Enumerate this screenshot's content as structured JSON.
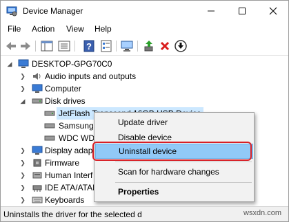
{
  "window": {
    "title": "Device Manager"
  },
  "menu": [
    "File",
    "Action",
    "View",
    "Help"
  ],
  "tree": {
    "root": "DESKTOP-GPG70C0",
    "items": [
      {
        "label": "Audio inputs and outputs"
      },
      {
        "label": "Computer"
      },
      {
        "label": "Disk drives"
      },
      {
        "label": "JetFlash Transcend 16GB USB Device"
      },
      {
        "label": "Samsung"
      },
      {
        "label": "WDC WD"
      },
      {
        "label": "Display adapt"
      },
      {
        "label": "Firmware"
      },
      {
        "label": "Human Interf"
      },
      {
        "label": "IDE ATA/ATAP"
      },
      {
        "label": "Keyboards"
      }
    ]
  },
  "context_menu": {
    "items": [
      "Update driver",
      "Disable device",
      "Uninstall device",
      "Scan for hardware changes",
      "Properties"
    ],
    "highlighted": "Uninstall device"
  },
  "status": {
    "text": "Uninstalls the driver for the selected d"
  },
  "watermark": "wsxdn.com",
  "colors": {
    "selection": "#cce8ff",
    "highlight": "#91c9f7",
    "annotation": "#d71f26"
  }
}
